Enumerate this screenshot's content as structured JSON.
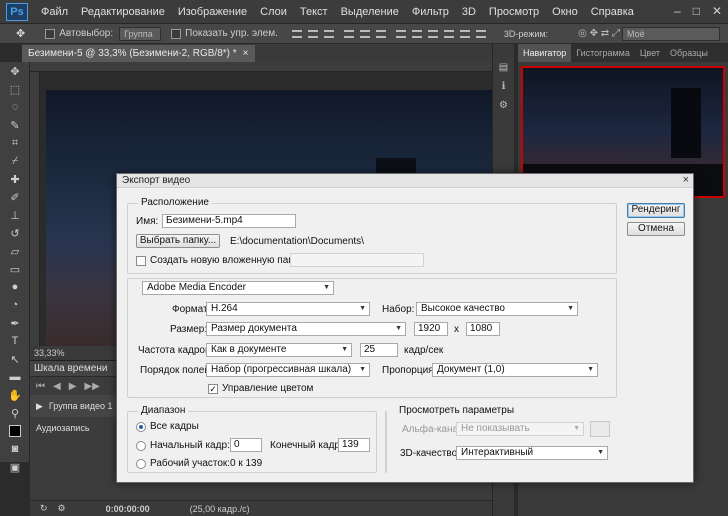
{
  "menubar": {
    "logo": "Ps",
    "items": [
      "Файл",
      "Редактирование",
      "Изображение",
      "Слои",
      "Текст",
      "Выделение",
      "Фильтр",
      "3D",
      "Просмотр",
      "Окно",
      "Справка"
    ],
    "window_controls": [
      "‒",
      "□",
      "✕"
    ]
  },
  "options_bar": {
    "autoselect_label": "Автовыбор:",
    "autoselect_value": "Группа",
    "show_controls_label": "Показать упр. элем.",
    "mode_label": "3D-режим:",
    "workspace_value": "Моё"
  },
  "document": {
    "tab_title": "Безимени-5 @ 33,3% (Безимени-2, RGB/8*) *",
    "tab_close": "×",
    "zoom": "33,33%"
  },
  "navigator": {
    "tabs": [
      "Навигатор",
      "Гистограмма",
      "Цвет",
      "Образцы"
    ]
  },
  "timeline": {
    "title": "Шкала времени",
    "track_group": "Группа видео 1",
    "track_audio": "Аудиозапись",
    "timecode": "0:00:00:00",
    "fps": "(25,00 кадр./с)"
  },
  "dialog": {
    "title": "Экспорт видео",
    "close": "×",
    "location": {
      "group_title": "Расположение",
      "name_label": "Имя:",
      "name_value": "Безимени-5.mp4",
      "choose_folder_button": "Выбрать папку...",
      "folder_path": "E:\\documentation\\Documents\\",
      "create_subfolder_label": "Создать новую вложенную папку:",
      "subfolder_value": ""
    },
    "render_button": "Рендеринг",
    "cancel_button": "Отмена",
    "encoder": {
      "selected": "Adobe Media Encoder",
      "format_label": "Формат:",
      "format_value": "H.264",
      "preset_label": "Набор:",
      "preset_value": "Высокое качество",
      "size_label": "Размер:",
      "size_value": "Размер документа",
      "width": "1920",
      "size_x": "x",
      "height": "1080",
      "framerate_label": "Частота кадров:",
      "framerate_value": "Как в документе",
      "fps_value": "25",
      "fps_unit": "кадр/сек",
      "field_order_label": "Порядок полей:",
      "field_order_value": "Набор (прогрессивная шкала)",
      "aspect_label": "Пропорция:",
      "aspect_value": "Документ (1,0)",
      "color_mgmt_label": "Управление цветом",
      "color_mgmt_checked": true
    },
    "range": {
      "group_title": "Диапазон",
      "all_frames": "Все кадры",
      "start_frame_label": "Начальный кадр:",
      "start_frame_value": "0",
      "end_frame_label": "Конечный кадр:",
      "end_frame_value": "139",
      "work_area_label": "Рабочий участок:",
      "work_area_value": "0 к 139",
      "selected": "all_frames"
    },
    "preview": {
      "group_title": "Просмотреть параметры",
      "alpha_label": "Альфа-канал:",
      "alpha_value": "Не показывать",
      "quality_label": "3D-качество:",
      "quality_value": "Интерактивный"
    }
  }
}
